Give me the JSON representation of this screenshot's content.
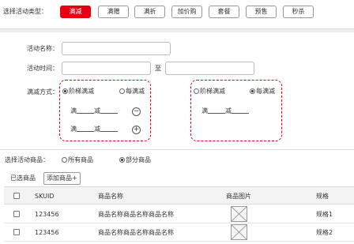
{
  "activity_type": {
    "label": "选择活动类型：",
    "options": [
      "满减",
      "满赠",
      "满折",
      "加价购",
      "套餐",
      "预售",
      "秒杀"
    ],
    "selected": "满减"
  },
  "form": {
    "name_label": "活动名称：",
    "time_label": "活动时间：",
    "time_separator": "至",
    "rule_label": "满减方式："
  },
  "rule_left": {
    "option1": "阶梯满减",
    "option2": "每满减",
    "selected": "阶梯满减",
    "row_text_man": "满",
    "row_text_jian": "减",
    "minus_symbol": "−",
    "plus_symbol": "+"
  },
  "rule_right": {
    "option1": "阶梯满减",
    "option2": "每满减",
    "selected": "每满减",
    "row_text_man": "满",
    "row_text_jian": "减"
  },
  "product_scope": {
    "label": "选择活动商品：",
    "option1": "所有商品",
    "option2": "部分商品",
    "selected": "部分商品"
  },
  "selected_products": {
    "label": "已选商品",
    "add_button": "添加商品+"
  },
  "table": {
    "headers": [
      "SKUID",
      "商品名称",
      "商品图片",
      "规格"
    ],
    "rows": [
      {
        "skuid": "123456",
        "name": "商品名称商品名称商品名称",
        "spec": "规格1"
      },
      {
        "skuid": "123456",
        "name": "商品名称商品名称商品名称",
        "spec": "规格2"
      }
    ]
  },
  "colors": {
    "accent": "#e60012"
  }
}
